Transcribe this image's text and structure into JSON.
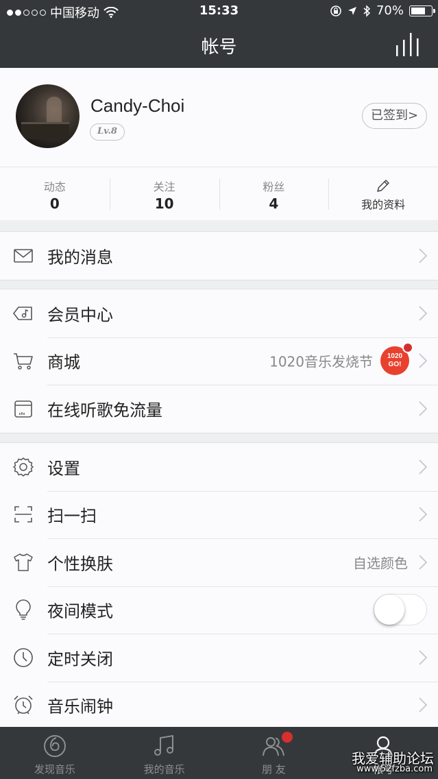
{
  "status_bar": {
    "carrier": "中国移动",
    "time": "15:33",
    "battery": "70%",
    "battery_level": 0.7
  },
  "nav": {
    "title": "帐号"
  },
  "profile": {
    "username": "Candy-Choi",
    "level": "Lv.8",
    "checkin_label": "已签到>"
  },
  "stats": [
    {
      "label": "动态",
      "value": "0"
    },
    {
      "label": "关注",
      "value": "10"
    },
    {
      "label": "粉丝",
      "value": "4"
    }
  ],
  "profile_edit_label": "我的资料",
  "menu": {
    "messages": "我的消息",
    "vip_center": "会员中心",
    "shop": "商城",
    "shop_promo": "1020音乐发烧节",
    "shop_badge": "1020 GO!",
    "data_free": "在线听歌免流量",
    "settings": "设置",
    "scan": "扫一扫",
    "skin": "个性换肤",
    "skin_value": "自选颜色",
    "night_mode": "夜间模式",
    "night_mode_on": false,
    "timer_off": "定时关闭",
    "alarm": "音乐闹钟"
  },
  "tabbar": {
    "tabs": [
      {
        "label": "发现音乐"
      },
      {
        "label": "我的音乐"
      },
      {
        "label": "朋 友"
      },
      {
        "label": "帐号"
      }
    ]
  },
  "watermark": {
    "title": "我爱辅助论坛",
    "url": "www.52fzba.com"
  },
  "colors": {
    "header_bg": "#34383a",
    "accent_red": "#d5302e",
    "page_bg": "#eeeff0"
  }
}
